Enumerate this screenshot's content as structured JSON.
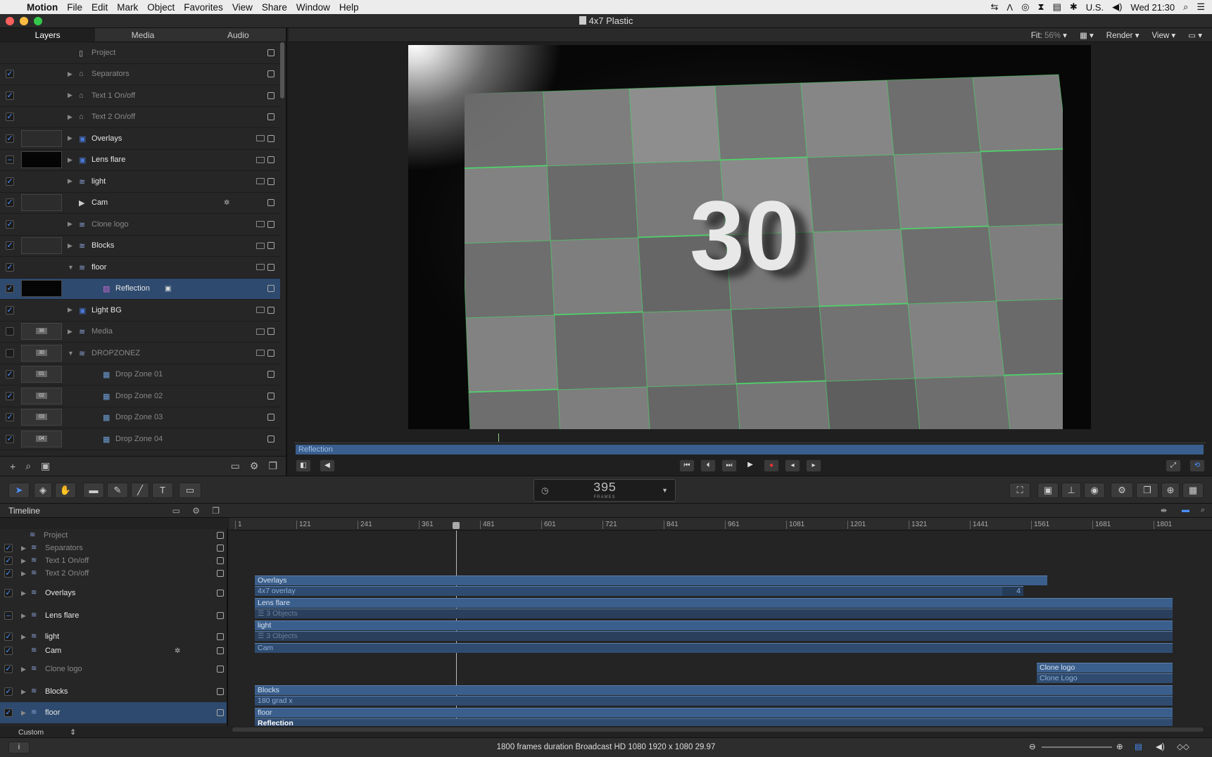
{
  "menubar": {
    "app": "Motion",
    "items": [
      "File",
      "Edit",
      "Mark",
      "Object",
      "Favorites",
      "View",
      "Share",
      "Window",
      "Help"
    ],
    "input_source": "U.S.",
    "clock": "Wed 21:30"
  },
  "window": {
    "title": "4x7 Plastic"
  },
  "left_tabs": [
    "Layers",
    "Media",
    "Audio"
  ],
  "layers": [
    {
      "name": "Project",
      "checked": null,
      "indent": 0,
      "expand": "",
      "icon": "project",
      "thumb": "none",
      "dim": true
    },
    {
      "name": "Separators",
      "checked": true,
      "indent": 1,
      "expand": "▶",
      "icon": "group",
      "thumb": "none",
      "dim": true
    },
    {
      "name": "Text 1 On/off",
      "checked": true,
      "indent": 1,
      "expand": "▶",
      "icon": "group",
      "thumb": "none",
      "dim": true
    },
    {
      "name": "Text 2 On/off",
      "checked": true,
      "indent": 1,
      "expand": "▶",
      "icon": "group",
      "thumb": "none",
      "dim": true
    },
    {
      "name": "Overlays",
      "checked": true,
      "indent": 1,
      "expand": "▶",
      "icon": "group2d",
      "thumb": "grey",
      "dim": false
    },
    {
      "name": "Lens flare",
      "checked": "mixed",
      "indent": 1,
      "expand": "▶",
      "icon": "group2d",
      "thumb": "dark",
      "dim": false
    },
    {
      "name": "light",
      "checked": true,
      "indent": 1,
      "expand": "▶",
      "icon": "group3d",
      "thumb": "none",
      "dim": false
    },
    {
      "name": "Cam",
      "checked": true,
      "indent": 1,
      "expand": "",
      "icon": "camera",
      "thumb": "grey",
      "dim": false
    },
    {
      "name": "Clone logo",
      "checked": true,
      "indent": 1,
      "expand": "▶",
      "icon": "group3d",
      "thumb": "none",
      "dim": true
    },
    {
      "name": "Blocks",
      "checked": true,
      "indent": 1,
      "expand": "▶",
      "icon": "group3d",
      "thumb": "grey",
      "dim": false
    },
    {
      "name": "floor",
      "checked": true,
      "indent": 1,
      "expand": "▼",
      "icon": "group3d",
      "thumb": "none",
      "dim": false
    },
    {
      "name": "Reflection",
      "checked": true,
      "indent": 2,
      "expand": "",
      "icon": "filter",
      "thumb": "dark",
      "dim": false,
      "selected": true
    },
    {
      "name": "Light BG",
      "checked": true,
      "indent": 1,
      "expand": "▶",
      "icon": "group2d",
      "thumb": "none",
      "dim": false
    },
    {
      "name": "Media",
      "checked": false,
      "indent": 1,
      "expand": "▶",
      "icon": "group3d",
      "thumb": "num",
      "thumbtext": "36",
      "dim": true
    },
    {
      "name": "DROPZONEZ",
      "checked": false,
      "indent": 1,
      "expand": "▼",
      "icon": "group3d",
      "thumb": "num",
      "thumbtext": "30",
      "dim": true
    },
    {
      "name": "Drop Zone 01",
      "checked": true,
      "indent": 2,
      "expand": "",
      "icon": "image",
      "thumb": "num",
      "thumbtext": "01",
      "dim": true
    },
    {
      "name": "Drop Zone 02",
      "checked": true,
      "indent": 2,
      "expand": "",
      "icon": "image",
      "thumb": "num",
      "thumbtext": "02",
      "dim": true
    },
    {
      "name": "Drop Zone 03",
      "checked": true,
      "indent": 2,
      "expand": "",
      "icon": "image",
      "thumb": "num",
      "thumbtext": "03",
      "dim": true
    },
    {
      "name": "Drop Zone 04",
      "checked": true,
      "indent": 2,
      "expand": "",
      "icon": "image",
      "thumb": "num",
      "thumbtext": "04",
      "dim": true
    }
  ],
  "canvas_toolbar": {
    "fit_label": "Fit:",
    "fit_value": "56%",
    "render": "Render",
    "view": "View"
  },
  "canvas": {
    "big_number": "30",
    "selected_clip": "Reflection"
  },
  "timecode": {
    "value": "395",
    "unit": "FRAMES"
  },
  "timeline": {
    "title": "Timeline",
    "ruler": [
      "1",
      "121",
      "241",
      "361",
      "481",
      "601",
      "721",
      "841",
      "961",
      "1081",
      "1201",
      "1321",
      "1441",
      "1561",
      "1681",
      "1801"
    ],
    "layers": [
      {
        "name": "Project",
        "checked": null,
        "expand": "",
        "dim": true
      },
      {
        "name": "Separators",
        "checked": true,
        "expand": "▶",
        "dim": true
      },
      {
        "name": "Text 1 On/off",
        "checked": true,
        "expand": "▶",
        "dim": true
      },
      {
        "name": "Text 2 On/off",
        "checked": true,
        "expand": "▶",
        "dim": true
      },
      {
        "name": "Overlays",
        "checked": true,
        "expand": "▶",
        "dim": false
      },
      {
        "name": "Lens flare",
        "checked": "mixed",
        "expand": "▶",
        "dim": false
      },
      {
        "name": "light",
        "checked": true,
        "expand": "▶",
        "dim": false
      },
      {
        "name": "Cam",
        "checked": true,
        "expand": "",
        "dim": false
      },
      {
        "name": "Clone logo",
        "checked": true,
        "expand": "▶",
        "dim": true
      },
      {
        "name": "Blocks",
        "checked": true,
        "expand": "▶",
        "dim": false
      },
      {
        "name": "floor",
        "checked": true,
        "expand": "▶",
        "dim": false,
        "selected": true
      }
    ],
    "clips": [
      {
        "label": "Overlays"
      },
      {
        "label": "4x7 overlay",
        "badge": "4"
      },
      {
        "label": "Lens flare"
      },
      {
        "label": "3 Objects"
      },
      {
        "label": "light"
      },
      {
        "label": "3 Objects"
      },
      {
        "label": "Cam"
      },
      {
        "label": "Clone logo"
      },
      {
        "label": "Clone Logo"
      },
      {
        "label": "Blocks"
      },
      {
        "label": "180 grad x"
      },
      {
        "label": "floor"
      },
      {
        "label": "Reflection"
      }
    ],
    "footer_preset": "Custom"
  },
  "status": {
    "text": "1800 frames duration Broadcast HD 1080 1920 x 1080 29.97"
  },
  "colors": {
    "accent": "#4a90ff",
    "clip": "#3b5f8c",
    "selection": "#2e4a6e",
    "green_edge": "#4fd36a"
  }
}
